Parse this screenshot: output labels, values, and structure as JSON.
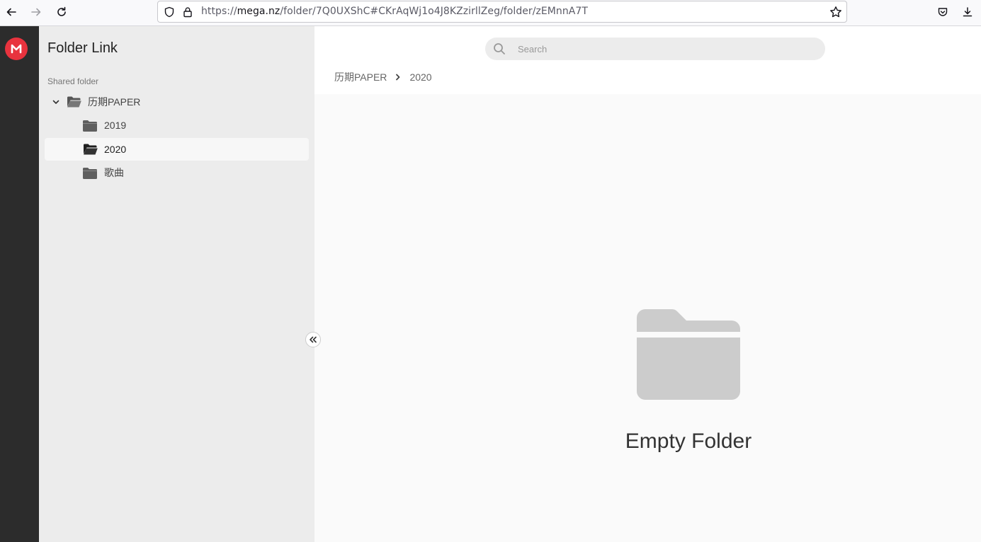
{
  "browser": {
    "url_prefix": "https://",
    "url_host": "mega.nz",
    "url_path": "/folder/7Q0UXShC#CKrAqWj1o4J8KZzirllZeg/folder/zEMnnA7T"
  },
  "sidebar": {
    "title": "Folder Link",
    "section_label": "Shared folder",
    "tree": {
      "root": {
        "label": "历期PAPER"
      },
      "children": [
        {
          "label": "2019"
        },
        {
          "label": "2020"
        },
        {
          "label": "歌曲"
        }
      ]
    }
  },
  "main": {
    "search_placeholder": "Search",
    "breadcrumb": [
      "历期PAPER",
      "2020"
    ],
    "empty_text": "Empty Folder"
  },
  "colors": {
    "brand": "#e8333e",
    "rail": "#2c2c2c",
    "sidebar": "#ececec",
    "content": "#fafafa",
    "empty_icon": "#cccccc"
  }
}
